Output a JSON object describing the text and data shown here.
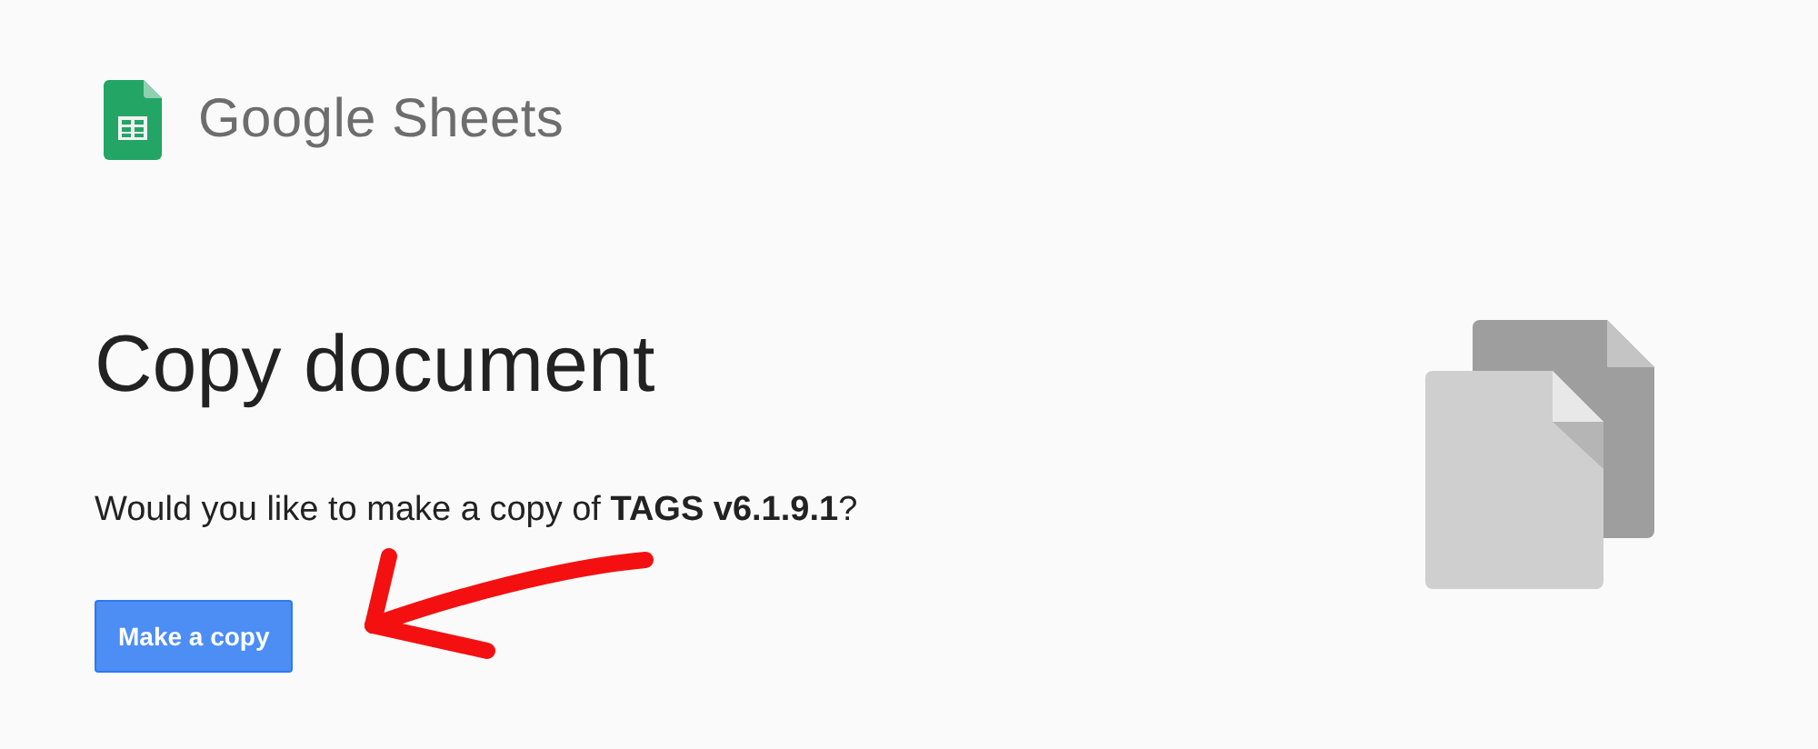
{
  "header": {
    "product": "Google Sheets"
  },
  "title": "Copy document",
  "message": "Would you like to make a copy of **TAGS v6.1.9.1**?",
  "button": "Make a copy"
}
